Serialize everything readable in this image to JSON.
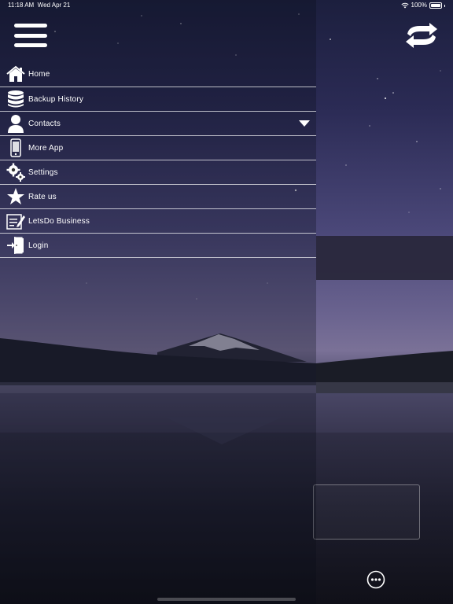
{
  "status_bar": {
    "time": "11:18 AM",
    "date": "Wed Apr 21",
    "battery": "100%"
  },
  "header": {
    "menu_icon": "hamburger-icon",
    "sync_icon": "sync-icon"
  },
  "drawer": {
    "items": [
      {
        "label": "Home",
        "icon": "home-icon"
      },
      {
        "label": "Backup History",
        "icon": "database-icon"
      },
      {
        "label": "Contacts",
        "icon": "user-icon",
        "expandable": true
      },
      {
        "label": "More App",
        "icon": "phone-icon"
      },
      {
        "label": "Settings",
        "icon": "gears-icon"
      },
      {
        "label": "Rate us",
        "icon": "star-icon"
      },
      {
        "label": "LetsDo Business",
        "icon": "edit-document-icon"
      },
      {
        "label": "Login",
        "icon": "login-door-icon"
      }
    ]
  },
  "footer": {
    "more_icon": "more-options-icon"
  },
  "colors": {
    "text": "#ffffff",
    "divider": "#ffffffb3",
    "sky_dark": "#1c1f3e",
    "sky_light": "#7a7197"
  }
}
